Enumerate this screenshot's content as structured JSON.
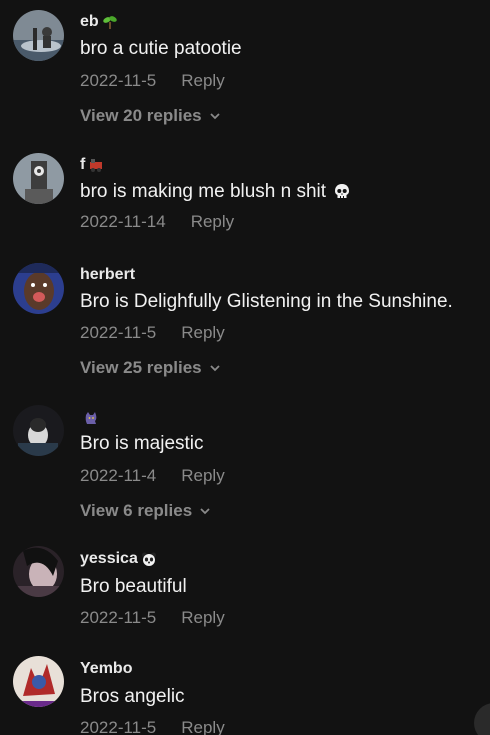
{
  "comments": [
    {
      "username": "eb",
      "username_emoji": "seedling-emoji",
      "text": "bro a cutie patootie",
      "date": "2022-11-5",
      "reply_label": "Reply",
      "view_replies": "View 20 replies"
    },
    {
      "username": "f",
      "username_emoji": "locomotive-emoji",
      "text": "bro is making me blush n shit",
      "text_emoji": "skull-emoji",
      "date": "2022-11-14",
      "reply_label": "Reply"
    },
    {
      "username": "herbert",
      "text": "Bro is Delighfully Glistening in the Sunshine.",
      "date": "2022-11-5",
      "reply_label": "Reply",
      "view_replies": "View 25 replies"
    },
    {
      "username": "",
      "username_emoji": "black-cat-emoji",
      "text": "Bro is majestic",
      "date": "2022-11-4",
      "reply_label": "Reply",
      "view_replies": "View 6 replies"
    },
    {
      "username": "yessica",
      "username_emoji": "panda-emoji",
      "text": "Bro beautiful",
      "date": "2022-11-5",
      "reply_label": "Reply"
    },
    {
      "username": "Yembo",
      "text": "Bros angelic",
      "date": "2022-11-5",
      "reply_label": "Reply"
    }
  ],
  "icons": {
    "view_replies_chevron": "chevron-down-icon"
  },
  "colors": {
    "background": "#121212",
    "primary_text": "#f1f1f1",
    "secondary_text": "#8a8a8a"
  }
}
